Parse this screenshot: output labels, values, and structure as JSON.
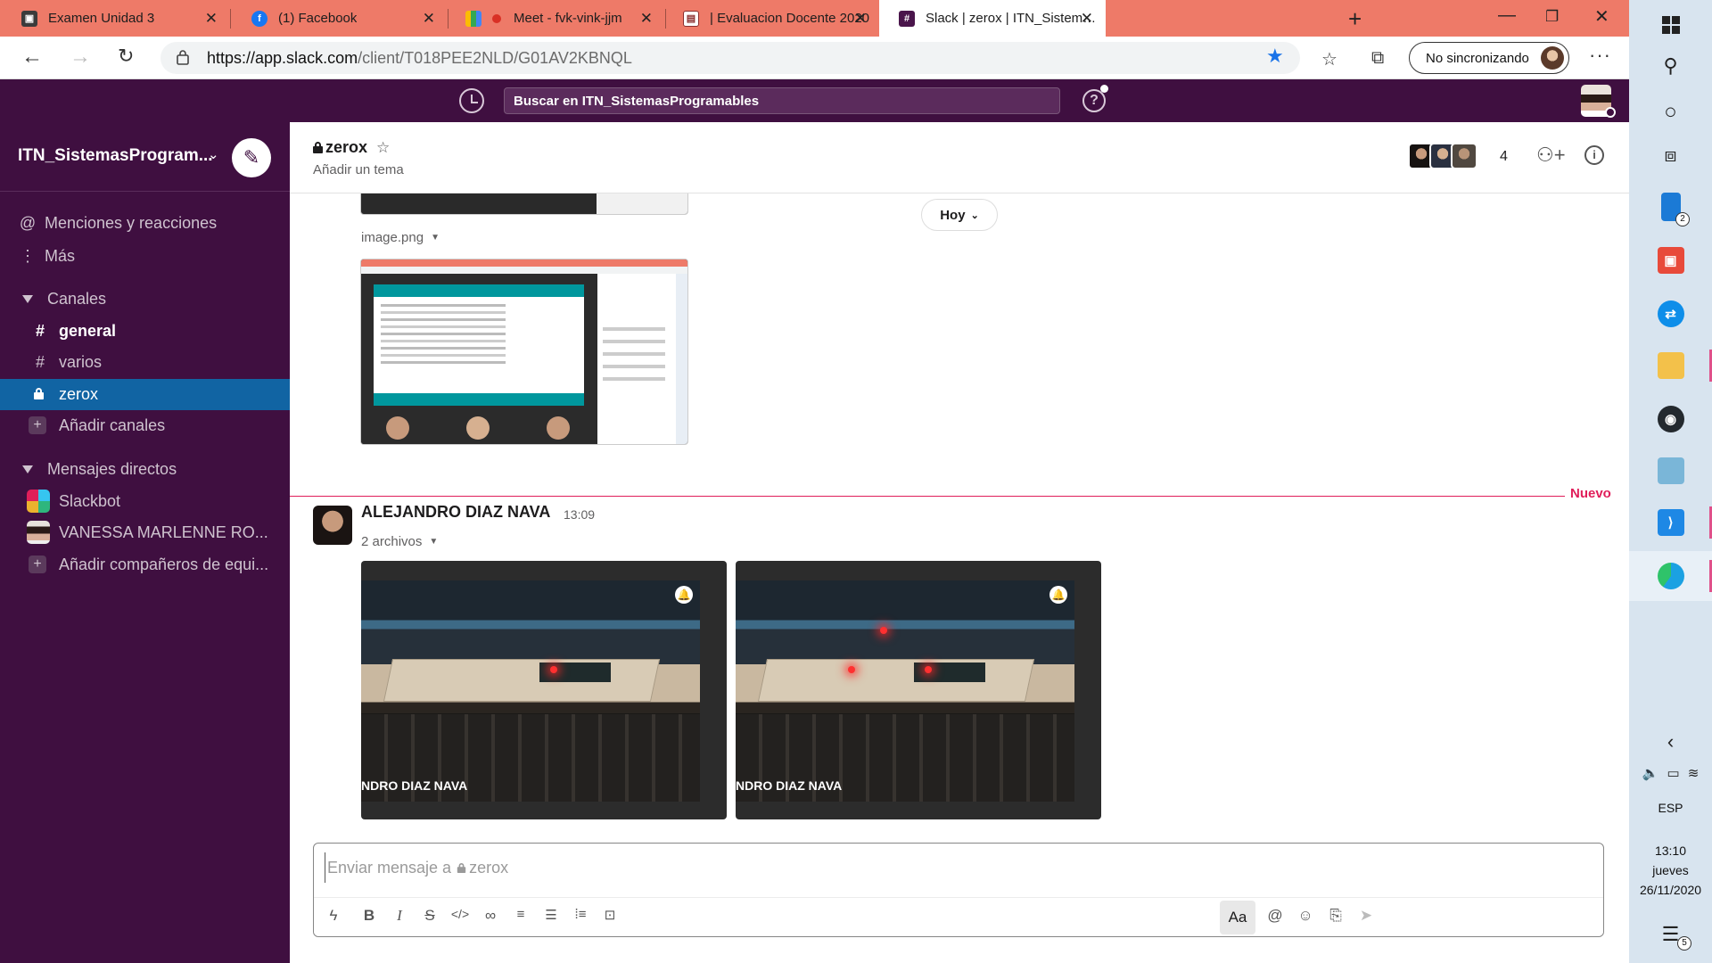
{
  "browser": {
    "tabs": [
      {
        "title": "Examen Unidad 3",
        "favicon": "doc-icon",
        "color": "#3b3b3b"
      },
      {
        "title": "(1) Facebook",
        "favicon": "facebook-icon",
        "color": "#1877f2"
      },
      {
        "title": "Meet - fvk-vink-jjm",
        "favicon": "meet-icon",
        "color": "#00897b"
      },
      {
        "title": "| Evaluacion Docente 2020",
        "favicon": "form-icon",
        "color": "#8a2d2d"
      },
      {
        "title": "Slack | zerox | ITN_SistemasProgr",
        "favicon": "slack-icon",
        "color": "#4a154b"
      }
    ],
    "url_host": "https://app.slack.com",
    "url_path": "/client/T018PEE2NLD/G01AV2KBNQL",
    "sync_label": "No sincronizando",
    "tab_bar_color": "#ee7a68"
  },
  "slack": {
    "search_placeholder": "Buscar en ITN_SistemasProgramables",
    "workspace_name": "ITN_SistemasProgram...",
    "sidebar": {
      "mentions": "Menciones y reacciones",
      "more": "Más",
      "channels_header": "Canales",
      "channels": [
        {
          "name": "general",
          "bold": true,
          "selected": false,
          "private": false
        },
        {
          "name": "varios",
          "bold": false,
          "selected": false,
          "private": false
        },
        {
          "name": "zerox",
          "bold": false,
          "selected": true,
          "private": true
        }
      ],
      "add_channels": "Añadir canales",
      "dm_header": "Mensajes directos",
      "dms": [
        {
          "name": "Slackbot"
        },
        {
          "name": "VANESSA MARLENNE RO..."
        }
      ],
      "add_teammates": "Añadir compañeros de equi..."
    },
    "channel": {
      "name": "zerox",
      "topic": "Añadir un tema",
      "member_count": "4"
    },
    "messages": {
      "day_divider": "Hoy",
      "image_file_name": "image.png",
      "new_label": "Nuevo",
      "author": "ALEJANDRO DIAZ NAVA",
      "time": "13:09",
      "files_label": "2 archivos",
      "video_caption": "NDRO DIAZ NAVA"
    },
    "composer": {
      "placeholder_prefix": "Enviar mensaje a",
      "placeholder_channel": "zerox",
      "format_label": "Aa"
    },
    "colors": {
      "aubergine": "#3f0f40",
      "selected": "#1164a3",
      "new_red": "#e01e5a"
    }
  },
  "taskbar": {
    "language": "ESP",
    "time": "13:10",
    "day": "jueves",
    "date": "26/11/2020",
    "notif_count": "5",
    "phone_badge": "2"
  }
}
